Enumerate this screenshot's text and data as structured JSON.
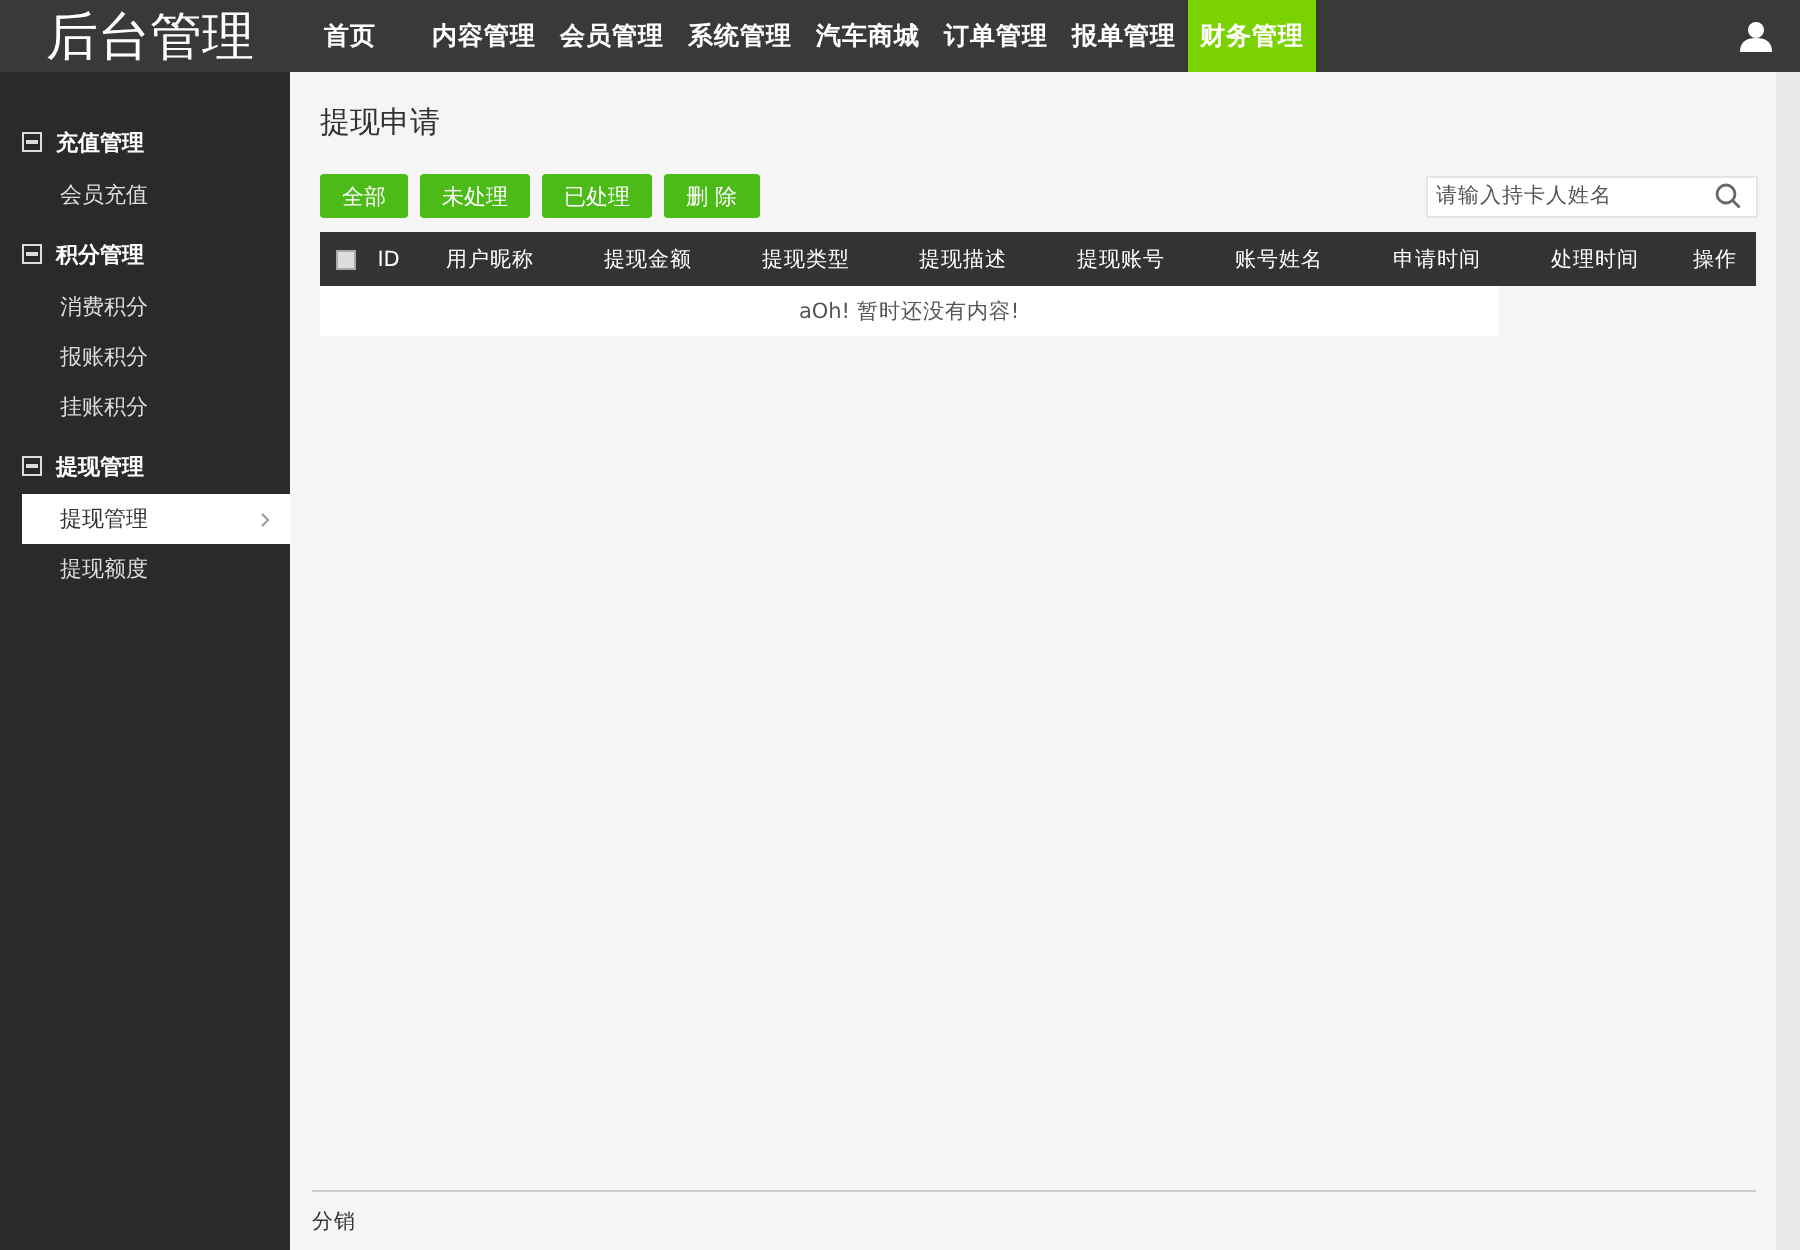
{
  "header": {
    "logo": "后台管理",
    "nav": [
      {
        "label": "首页",
        "selected": false
      },
      {
        "label": "内容管理",
        "selected": false
      },
      {
        "label": "会员管理",
        "selected": false
      },
      {
        "label": "系统管理",
        "selected": false
      },
      {
        "label": "汽车商城",
        "selected": false
      },
      {
        "label": "订单管理",
        "selected": false
      },
      {
        "label": "报单管理",
        "selected": false
      },
      {
        "label": "财务管理",
        "selected": true
      }
    ]
  },
  "sidebar": {
    "groups": [
      {
        "label": "充值管理",
        "expanded": true,
        "children": [
          {
            "label": "会员充值",
            "selected": false
          }
        ]
      },
      {
        "label": "积分管理",
        "expanded": true,
        "children": [
          {
            "label": "消费积分",
            "selected": false
          },
          {
            "label": "报账积分",
            "selected": false
          },
          {
            "label": "挂账积分",
            "selected": false
          }
        ]
      },
      {
        "label": "提现管理",
        "expanded": true,
        "children": [
          {
            "label": "提现管理",
            "selected": true
          },
          {
            "label": "提现额度",
            "selected": false
          }
        ]
      }
    ]
  },
  "main": {
    "title": "提现申请",
    "buttons": [
      "全部",
      "未处理",
      "已处理",
      "删 除"
    ],
    "search": {
      "placeholder": "请输入持卡人姓名"
    },
    "table": {
      "select_all": {
        "checked": false
      },
      "columns": [
        "ID",
        "用户昵称",
        "提现金额",
        "提现类型",
        "提现描述",
        "提现账号",
        "账号姓名",
        "申请时间",
        "处理时间",
        "操作"
      ],
      "empty_message": "aOh! 暂时还没有内容!"
    },
    "footer": "分销"
  }
}
